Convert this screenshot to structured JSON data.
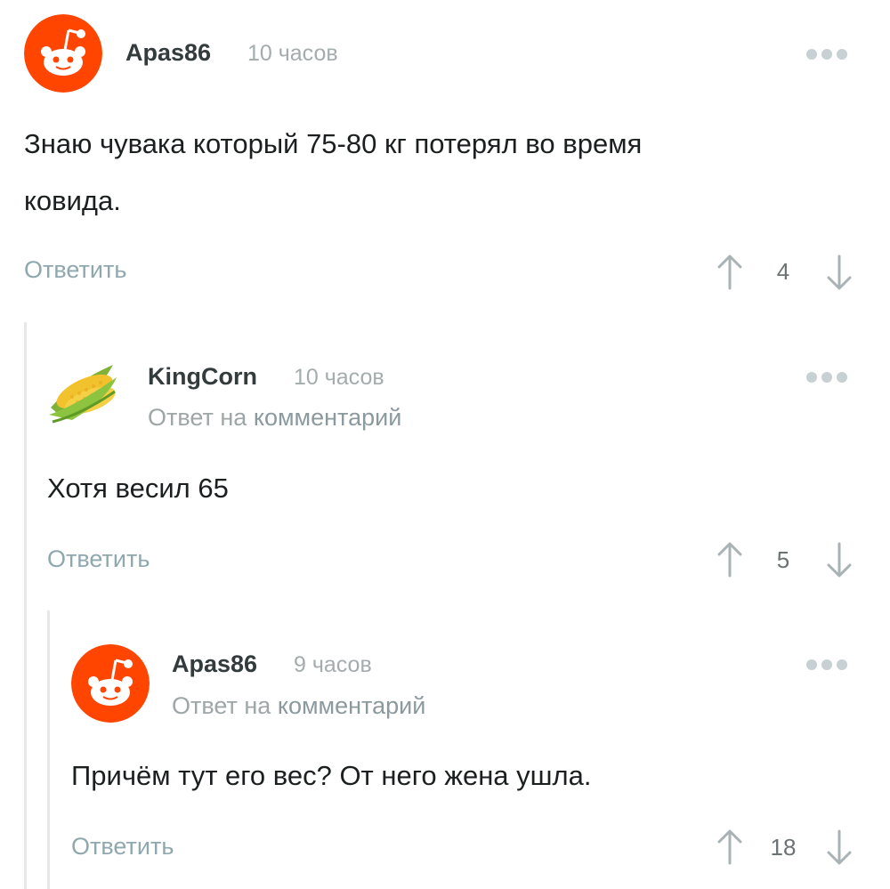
{
  "comments": [
    {
      "author": "Apas86",
      "time": "10 часов",
      "text_lines": [
        "Знаю чувака который 75-80 кг потерял  во время",
        "ковида."
      ],
      "reply_label": "Ответить",
      "score": "4",
      "avatar": "reddit-alien-icon"
    },
    {
      "author": "KingCorn",
      "time": "10 часов",
      "reply_prefix": "Ответ на",
      "reply_link": "комментарий",
      "text_lines": [
        "Хотя весил 65"
      ],
      "reply_label": "Ответить",
      "score": "5",
      "avatar": "corn-icon"
    },
    {
      "author": "Apas86",
      "time": "9 часов",
      "reply_prefix": "Ответ на",
      "reply_link": "комментарий",
      "text_lines": [
        "Причём тут его вес? От него жена ушла."
      ],
      "reply_label": "Ответить",
      "score": "18",
      "avatar": "reddit-alien-icon"
    }
  ],
  "colors": {
    "avatar_bg": "#ff4500",
    "action_text": "#8fa8ae",
    "thread_line": "#e6e9ea"
  }
}
